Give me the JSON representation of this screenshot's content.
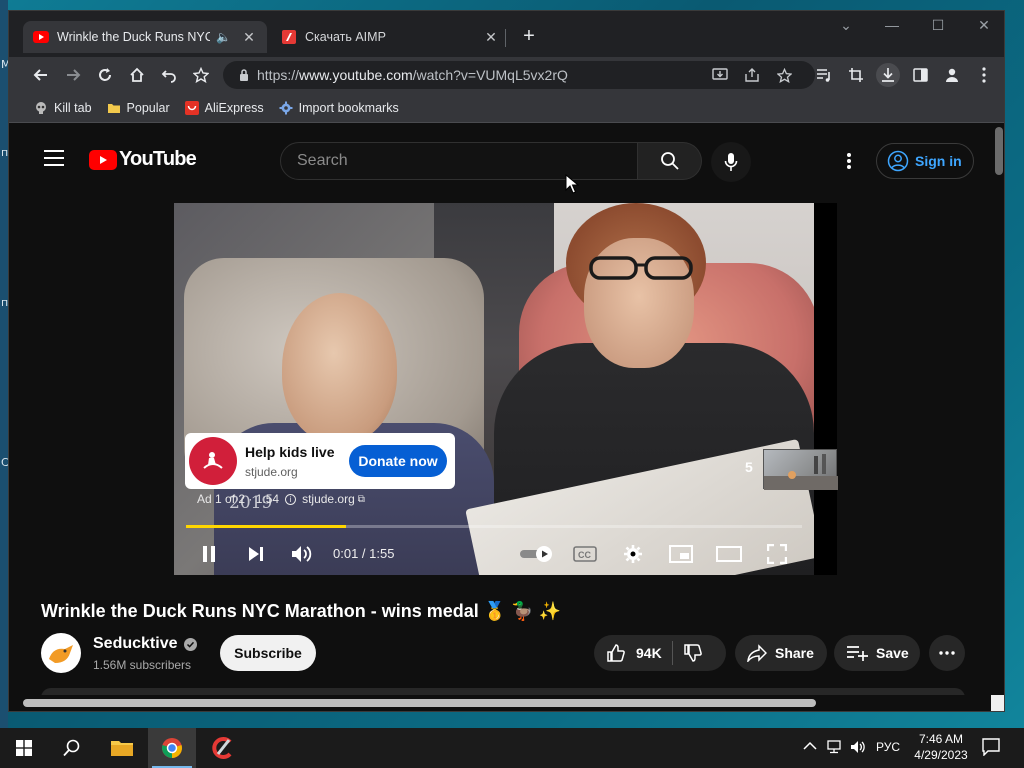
{
  "desktop": {
    "edge_chars": [
      "M",
      "п",
      "п",
      "С"
    ]
  },
  "browser": {
    "tabs": [
      {
        "title": "Wrinkle the Duck Runs NYC",
        "active": true,
        "playing_audio": true
      },
      {
        "title": "Скачать AIMP",
        "active": false
      }
    ],
    "close_glyph": "✕",
    "new_tab_glyph": "+",
    "window_controls": {
      "chevron": "⌄",
      "minimize": "—",
      "maximize": "☐",
      "close": "✕"
    },
    "address": {
      "scheme": "https://",
      "host": "www.youtube.com",
      "path": "/watch?v=VUMqL5vx2rQ"
    },
    "bookmarks": [
      {
        "label": "Kill tab",
        "icon": "skull-icon"
      },
      {
        "label": "Popular",
        "icon": "folder-icon"
      },
      {
        "label": "AliExpress",
        "icon": "aliexpress-icon"
      },
      {
        "label": "Import bookmarks",
        "icon": "gear-icon"
      }
    ]
  },
  "youtube": {
    "header": {
      "logo_text": "YouTube",
      "search_placeholder": "Search",
      "sign_in_label": "Sign in"
    },
    "ad": {
      "title": "Help kids live",
      "domain": "stjude.org",
      "cta": "Donate now",
      "status_prefix": "Ad 1 of 2 · 1:54",
      "status_domain": "stjude.org",
      "skip_countdown": "5",
      "video_overlay_text": "2019"
    },
    "player": {
      "time_display": "0:01 / 1:55",
      "progress_fraction": 0.26,
      "autoplay": true
    },
    "video": {
      "title": "Wrinkle the Duck Runs NYC Marathon - wins medal 🥇 🦆 ✨",
      "channel_name": "Seducktive",
      "subscribers": "1.56M subscribers",
      "subscribe_label": "Subscribe",
      "likes": "94K",
      "share_label": "Share",
      "save_label": "Save"
    }
  },
  "taskbar": {
    "language": "РУС",
    "time": "7:46 AM",
    "date": "4/29/2023"
  },
  "colors": {
    "youtube_red": "#ff0000",
    "link_blue": "#3ea6ff",
    "cta_blue": "#065fd4",
    "ad_progress": "#ffd700",
    "stjude_red": "#d11f3a"
  }
}
